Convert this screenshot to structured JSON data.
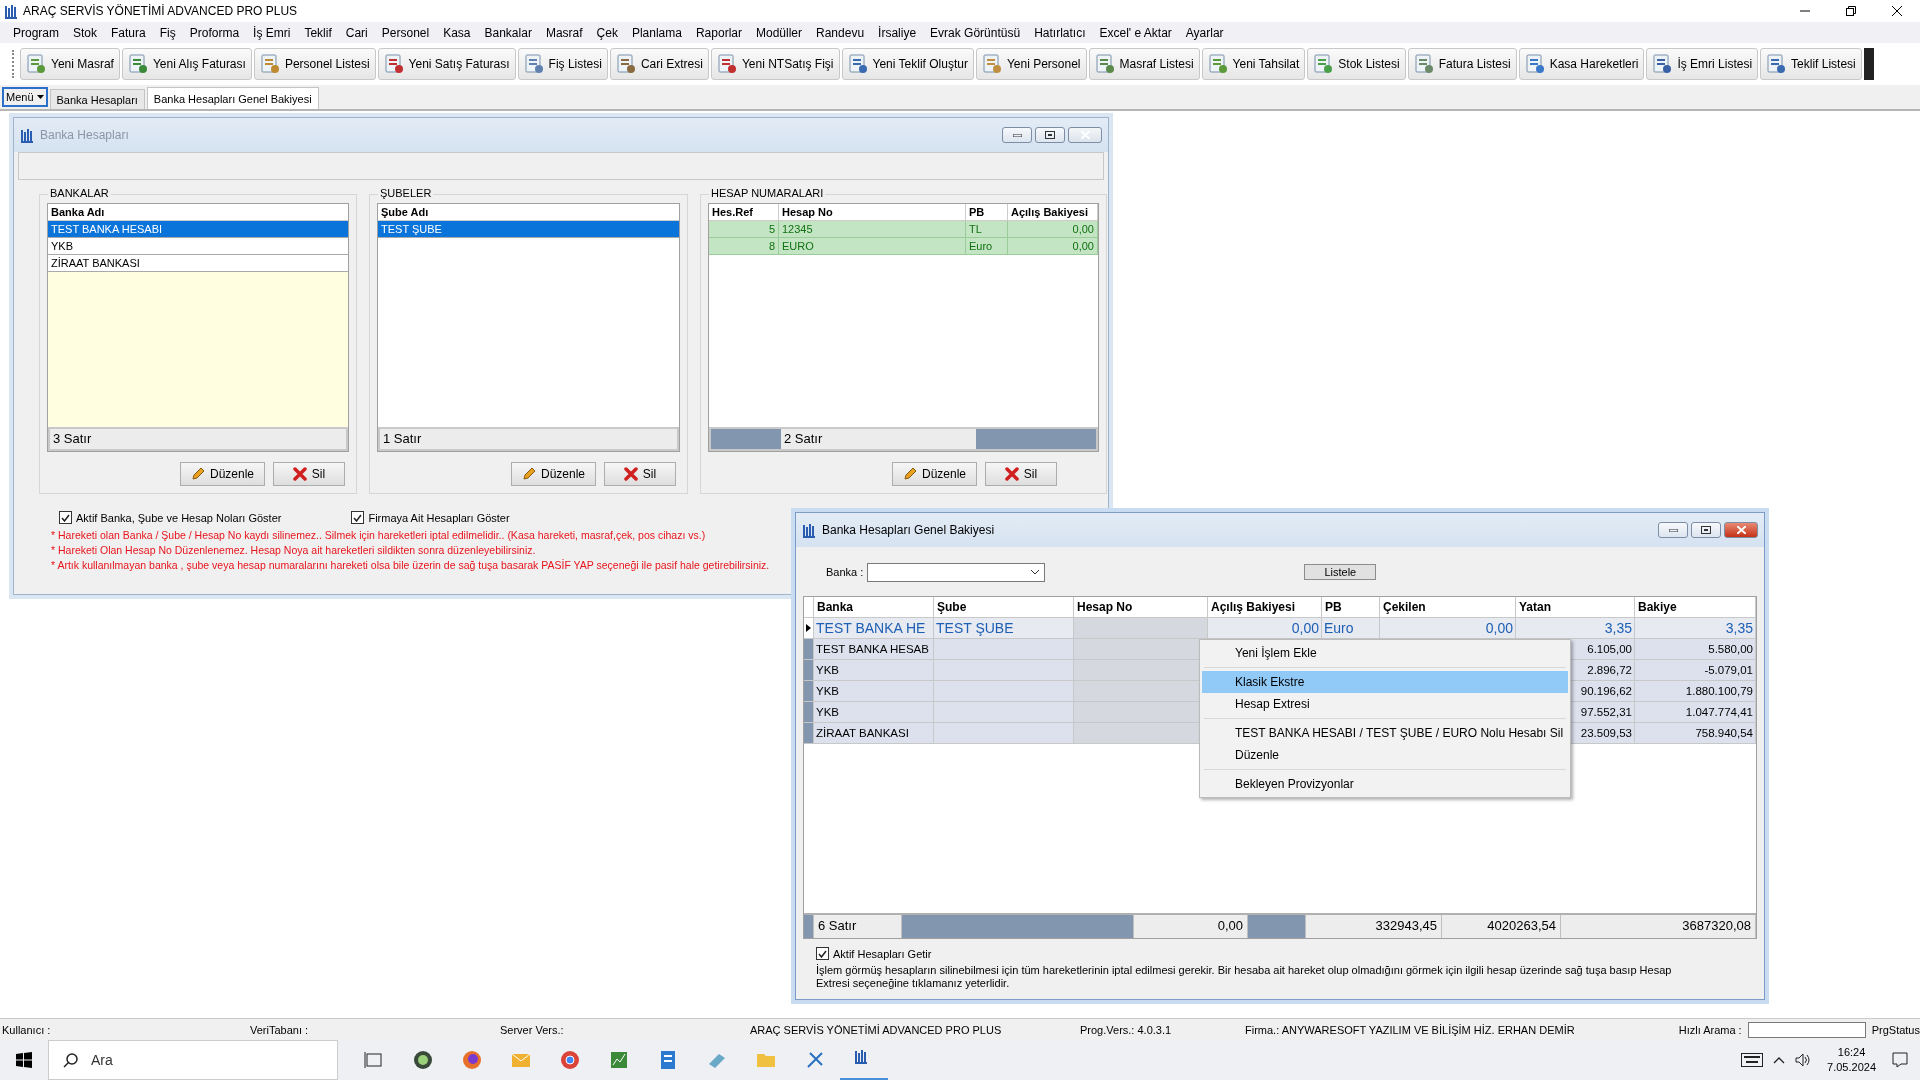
{
  "app_title": "ARAÇ SERVİS YÖNETİMİ ADVANCED PRO PLUS",
  "menu": [
    "Program",
    "Stok",
    "Fatura",
    "Fiş",
    "Proforma",
    "İş Emri",
    "Teklif",
    "Cari",
    "Personel",
    "Kasa",
    "Bankalar",
    "Masraf",
    "Çek",
    "Planlama",
    "Raporlar",
    "Modüller",
    "Randevu",
    "İrsaliye",
    "Evrak Görüntüsü",
    "Hatırlatıcı",
    "Excel' e Aktar",
    "Ayarlar"
  ],
  "toolbar": [
    "Yeni Masraf",
    "Yeni Alış Faturası",
    "Personel Listesi",
    "Yeni Satış Faturası",
    "Fiş Listesi",
    "Cari Extresi",
    "Yeni NTSatış Fişi",
    "Yeni Teklif Oluştur",
    "Yeni Personel",
    "Masraf Listesi",
    "Yeni Tahsilat",
    "Stok Listesi",
    "Fatura Listesi",
    "Kasa Hareketleri",
    "İş Emri Listesi",
    "Teklif Listesi"
  ],
  "menu_button": "Menü",
  "tabs": [
    {
      "label": "Banka Hesapları",
      "selected": false
    },
    {
      "label": "Banka Hesapları Genel Bakiyesi",
      "selected": true
    }
  ],
  "bank_window": {
    "title": "Banka Hesapları",
    "banks": {
      "title": "BANKALAR",
      "column": "Banka Adı",
      "edit_button": "Düzenle",
      "delete_button": "Sil",
      "rows": [
        {
          "name": "TEST BANKA HESABI",
          "selected": true
        },
        {
          "name": "YKB",
          "selected": false
        },
        {
          "name": "ZİRAAT BANKASI",
          "selected": false
        }
      ],
      "footer": "3 Satır"
    },
    "branches": {
      "title": "ŞUBELER",
      "column": "Şube Adı",
      "edit_button": "Düzenle",
      "delete_button": "Sil",
      "rows": [
        {
          "name": "TEST ŞUBE",
          "selected": true
        }
      ],
      "footer": "1 Satır"
    },
    "accounts": {
      "title": "HESAP NUMARALARI",
      "edit_button": "Düzenle",
      "delete_button": "Sil",
      "columns": [
        "Hes.Ref",
        "Hesap No",
        "PB",
        "Açılış Bakiyesi"
      ],
      "rows": [
        {
          "ref": "5",
          "no": "12345",
          "pb": "TL",
          "balance": "0,00"
        },
        {
          "ref": "8",
          "no": "EURO",
          "pb": "Euro",
          "balance": "0,00"
        }
      ],
      "footer": "2 Satır"
    },
    "checks": [
      {
        "label": "Aktif Banka, Şube ve Hesap Noları Göster",
        "checked": true
      },
      {
        "label": "Firmaya Ait Hesapları Göster",
        "checked": true
      }
    ],
    "notes": [
      "* Hareketi olan Banka / Şube / Hesap No kaydı silinemez.. Silmek için hareketleri iptal edilmelidir.. (Kasa hareketi, masraf,çek, pos cihazı vs.)",
      "* Hareketi Olan Hesap No Düzenlenemez. Hesap Noya ait hareketleri sildikten sonra düzenleyebilirsiniz.",
      "* Artık kullanılmayan banka , şube veya hesap numaralarını hareketi olsa bile üzerin de sağ tuşa basarak PASİF YAP seçeneği ile pasif hale getirebilirsiniz."
    ]
  },
  "balance_window": {
    "title": "Banka Hesapları Genel Bakiyesi",
    "bank_label": "Banka :",
    "list_button": "Listele",
    "columns": [
      "Banka",
      "Şube",
      "Hesap No",
      "Açılış Bakiyesi",
      "PB",
      "Çekilen",
      "Yatan",
      "Bakiye"
    ],
    "rows": [
      {
        "banka": "TEST BANKA HE",
        "sube": "TEST ŞUBE",
        "acilis": "0,00",
        "pb": "Euro",
        "cekilen": "0,00",
        "yatan": "3,35",
        "bakiye": "3,35",
        "selected": true
      },
      {
        "banka": "TEST BANKA HESAB",
        "yatan": "6.105,00",
        "bakiye": "5.580,00",
        "selected": false
      },
      {
        "banka": "YKB",
        "yatan": "2.896,72",
        "bakiye": "-5.079,01",
        "selected": false
      },
      {
        "banka": "YKB",
        "yatan": "90.196,62",
        "bakiye": "1.880.100,79",
        "selected": false
      },
      {
        "banka": "YKB",
        "yatan": "97.552,31",
        "bakiye": "1.047.774,41",
        "selected": false
      },
      {
        "banka": "ZİRAAT BANKASI",
        "yatan": "23.509,53",
        "bakiye": "758.940,54",
        "selected": false
      }
    ],
    "footer": {
      "count": "6 Satır",
      "acilis": "0,00",
      "cekilen": "332943,45",
      "yatan": "4020263,54",
      "bakiye": "3687320,08"
    },
    "check": {
      "label": "Aktif Hesapları Getir",
      "checked": true
    },
    "info": "İşlem görmüş hesapların silinebilmesi için tüm hareketlerinin iptal edilmesi gerekir. Bir hesaba ait hareket olup olmadığını görmek için ilgili hesap üzerinde sağ tuşa basıp Hesap Extresi seçeneğine tıklamanız yeterlidir.",
    "context_menu": [
      [
        {
          "label": "Yeni İşlem Ekle",
          "selected": false
        }
      ],
      [
        {
          "label": "Klasik Ekstre",
          "selected": true
        },
        {
          "label": "Hesap Extresi",
          "selected": false
        }
      ],
      [
        {
          "label": "TEST BANKA HESABI / TEST ŞUBE / EURO Nolu Hesabı Sil",
          "selected": false
        },
        {
          "label": "Düzenle",
          "selected": false
        }
      ],
      [
        {
          "label": "Bekleyen Provizyonlar",
          "selected": false
        }
      ]
    ]
  },
  "status_bar": [
    "Kullanıcı :",
    "VeriTabanı :",
    "Server Vers.:",
    "ARAÇ SERVİS YÖNETİMİ ADVANCED PRO PLUS",
    "Prog.Vers.: 4.0.3.1",
    "Firma.: ANYWARESOFT YAZILIM VE BİLİŞİM HİZ. ERHAN DEMİR"
  ],
  "quick_search": {
    "label": "Hızlı Arama :"
  },
  "prg_status": "PrgStatus",
  "taskbar": {
    "search_placeholder": "Ara",
    "time": "16:24",
    "date": "7.05.2024"
  }
}
